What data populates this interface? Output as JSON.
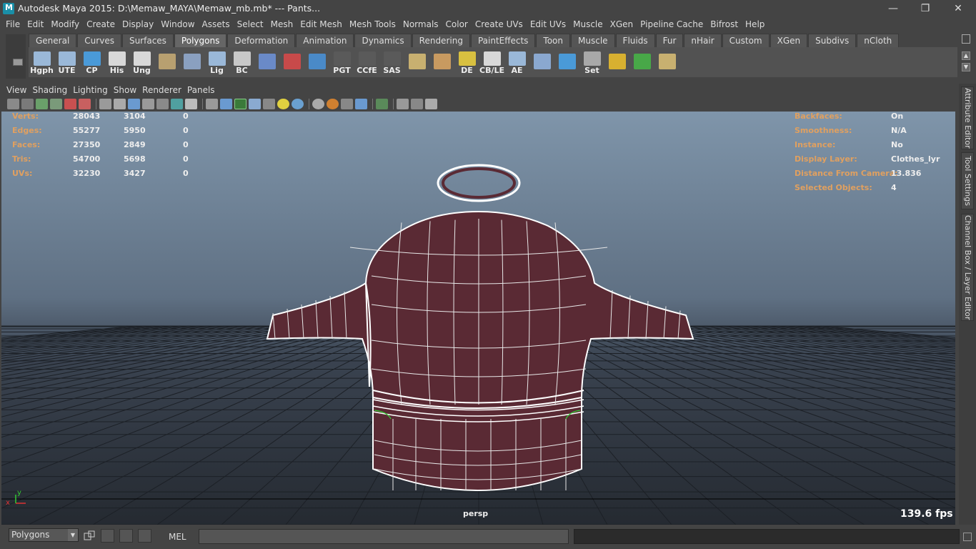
{
  "window": {
    "title": "Autodesk Maya 2015: D:\\Memaw_MAYA\\Memaw_mb.mb*   ---   Pants...",
    "controls": {
      "minimize": "—",
      "maximize": "❐",
      "close": "✕"
    }
  },
  "menubar": [
    "File",
    "Edit",
    "Modify",
    "Create",
    "Display",
    "Window",
    "Assets",
    "Select",
    "Mesh",
    "Edit Mesh",
    "Mesh Tools",
    "Normals",
    "Color",
    "Create UVs",
    "Edit UVs",
    "Muscle",
    "XGen",
    "Pipeline Cache",
    "Bifrost",
    "Help"
  ],
  "shelf": {
    "tabs": [
      "General",
      "Curves",
      "Surfaces",
      "Polygons",
      "Deformation",
      "Animation",
      "Dynamics",
      "Rendering",
      "PaintEffects",
      "Toon",
      "Muscle",
      "Fluids",
      "Fur",
      "nHair",
      "Custom",
      "XGen",
      "Subdivs",
      "nCloth"
    ],
    "active_tab": "Polygons",
    "icons": [
      {
        "label": "Hgph",
        "color": "#9ab8d8"
      },
      {
        "label": "UTE",
        "color": "#9ab8d8"
      },
      {
        "label": "CP",
        "color": "#4a9ad8"
      },
      {
        "label": "His",
        "color": "#d8d8d8"
      },
      {
        "label": "Ung",
        "color": "#d8d8d8"
      },
      {
        "label": "",
        "color": "#b8a070"
      },
      {
        "label": "",
        "color": "#8aa0c0"
      },
      {
        "label": "Lig",
        "color": "#9ab8d8"
      },
      {
        "label": "BC",
        "color": "#c8c8c8"
      },
      {
        "label": "",
        "color": "#6a8ac8"
      },
      {
        "label": "",
        "color": "#c84a4a"
      },
      {
        "label": "",
        "color": "#4a8ac8"
      },
      {
        "label": "PGT",
        "color": "#5a5a5a"
      },
      {
        "label": "CCfE",
        "color": "#5a5a5a"
      },
      {
        "label": "SAS",
        "color": "#5a5a5a"
      },
      {
        "label": "",
        "color": "#c8b070"
      },
      {
        "label": "",
        "color": "#c89a60"
      },
      {
        "label": "DE",
        "color": "#d8c040"
      },
      {
        "label": "CB/LE",
        "color": "#d8d8d8"
      },
      {
        "label": "AE",
        "color": "#9ab8d8"
      },
      {
        "label": "",
        "color": "#8aa8d0"
      },
      {
        "label": "",
        "color": "#4a9ad8"
      },
      {
        "label": "Set",
        "color": "#a8a8a8"
      },
      {
        "label": "",
        "color": "#d8b030"
      },
      {
        "label": "",
        "color": "#48a848"
      },
      {
        "label": "",
        "color": "#c8b070"
      }
    ]
  },
  "panel": {
    "menu": [
      "View",
      "Shading",
      "Lighting",
      "Show",
      "Renderer",
      "Panels"
    ]
  },
  "hud": {
    "left": [
      {
        "label": "Verts:",
        "v1": "28043",
        "v2": "3104",
        "v3": "0"
      },
      {
        "label": "Edges:",
        "v1": "55277",
        "v2": "5950",
        "v3": "0"
      },
      {
        "label": "Faces:",
        "v1": "27350",
        "v2": "2849",
        "v3": "0"
      },
      {
        "label": "Tris:",
        "v1": "54700",
        "v2": "5698",
        "v3": "0"
      },
      {
        "label": "UVs:",
        "v1": "32230",
        "v2": "3427",
        "v3": "0"
      }
    ],
    "right": [
      {
        "label": "Backfaces:",
        "value": "On"
      },
      {
        "label": "Smoothness:",
        "value": "N/A"
      },
      {
        "label": "Instance:",
        "value": "No"
      },
      {
        "label": "Display Layer:",
        "value": "Clothes_lyr"
      },
      {
        "label": "Distance From Camera:",
        "value": "13.836"
      },
      {
        "label": "Selected Objects:",
        "value": "4"
      }
    ],
    "camera": "persp",
    "fps": "139.6 fps",
    "axis": {
      "x": "x",
      "y": "y"
    }
  },
  "right_dock": [
    "Attribute Editor",
    "Tool Settings",
    "Channel Box / Layer Editor"
  ],
  "bottom": {
    "mode": "Polygons",
    "mel_label": "MEL",
    "mel_value": ""
  },
  "colors": {
    "mesh_fill": "#5a2a34",
    "wire": "#ffffff",
    "hud_label": "#e0a060"
  }
}
